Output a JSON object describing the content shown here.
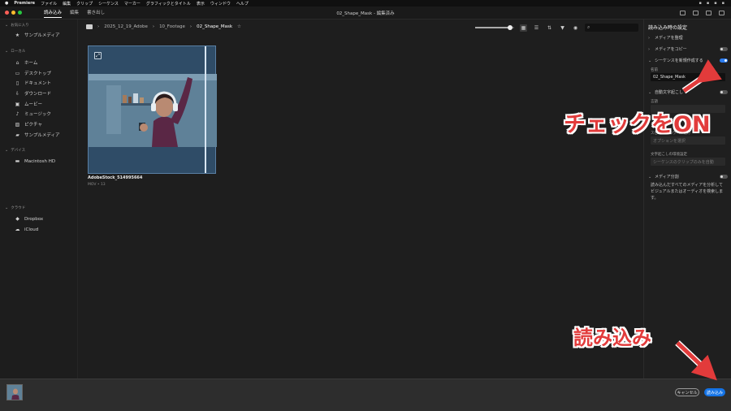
{
  "menubar": {
    "apple": "",
    "app": "Premiere",
    "items": [
      "ファイル",
      "編集",
      "クリップ",
      "シーケンス",
      "マーカー",
      "グラフィックとタイトル",
      "表示",
      "ウィンドウ",
      "ヘルプ"
    ]
  },
  "header": {
    "tabs": [
      "読み込み",
      "編集",
      "書き出し"
    ],
    "title": "02_Shape_Mask - 編集済み"
  },
  "sidebar": {
    "favorites_label": "お気に入り",
    "favorites": [
      {
        "icon": "star-icon",
        "label": "サンプルメディア"
      }
    ],
    "local_label": "ローカル",
    "local": [
      {
        "icon": "home-icon",
        "label": "ホーム"
      },
      {
        "icon": "desktop-icon",
        "label": "デスクトップ"
      },
      {
        "icon": "document-icon",
        "label": "ドキュメント"
      },
      {
        "icon": "download-icon",
        "label": "ダウンロード"
      },
      {
        "icon": "movie-icon",
        "label": "ムービー"
      },
      {
        "icon": "music-icon",
        "label": "ミュージック"
      },
      {
        "icon": "picture-icon",
        "label": "ピクチャ"
      },
      {
        "icon": "folder-icon",
        "label": "サンプルメディア"
      }
    ],
    "devices_label": "デバイス",
    "devices": [
      {
        "icon": "drive-icon",
        "label": "Macintosh HD"
      }
    ],
    "cloud_label": "クラウド",
    "cloud": [
      {
        "icon": "dropbox-icon",
        "label": "Dropbox"
      },
      {
        "icon": "cloud-icon",
        "label": "iCloud"
      }
    ]
  },
  "breadcrumbs": [
    "2025_12_19_Adobe",
    "10_Footage",
    "02_Shape_Mask"
  ],
  "toolbar": {
    "zoom_fraction": 0.9,
    "search_placeholder": ""
  },
  "clip": {
    "name": "AdobeStock_514995664",
    "meta": "MOV • 13"
  },
  "panel": {
    "title": "読み込み時の設定",
    "organize": "メディアを整理",
    "copy": "メディアをコピー",
    "new_sequence": "シーケンスを新規作成する",
    "name_label": "名前",
    "name_value": "02_Shape_Mask",
    "captions": "自動文字起こし",
    "language_label": "言語",
    "speaker_label": "スピーカーのラベル付け",
    "speaker_value": "オプションを選択",
    "transcript_label": "文字起こしの環境設定",
    "transcript_value": "シーケンスのクリップのみを自動",
    "split": "メディア分割",
    "split_desc": "読み込んだすべてのメディアを分析してビジュアルまたはオーディオを検索します。",
    "organize_on": false,
    "copy_on": false,
    "new_sequence_on": true,
    "captions_on": false,
    "split_on": false
  },
  "footer": {
    "cancel": "キャンセル",
    "import": "読み込み"
  },
  "annotations": {
    "check_on": "チェックをON",
    "import_note": "読み込み",
    "color": "#e23b3b"
  }
}
